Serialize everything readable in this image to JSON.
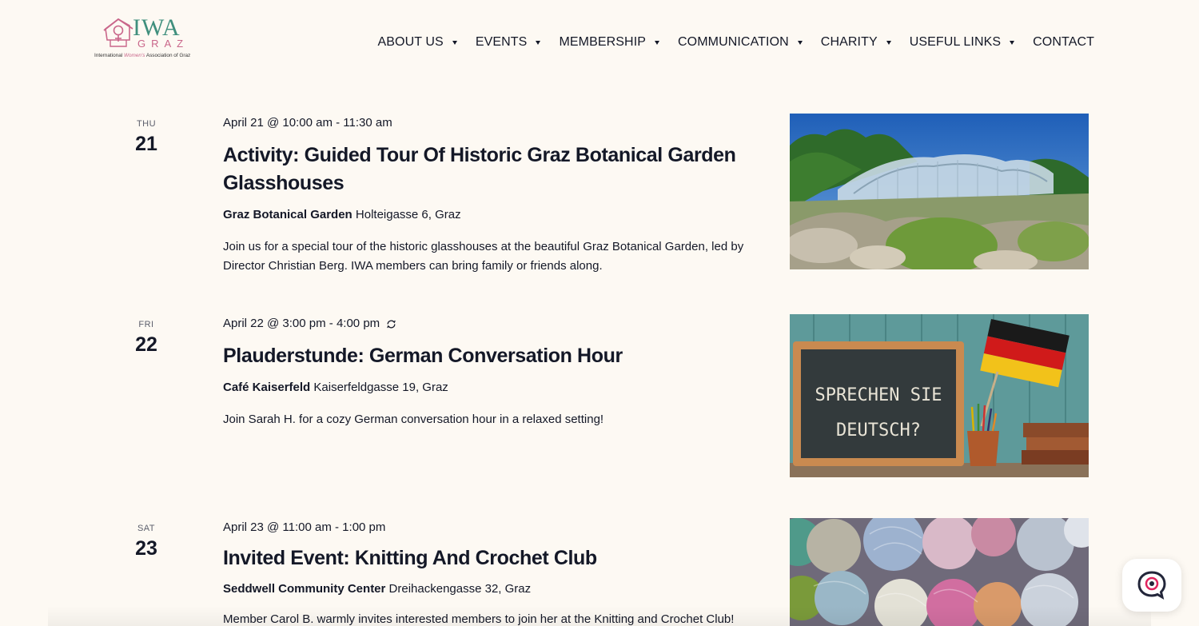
{
  "logo": {
    "word": "IWA",
    "sub": "GRAZ",
    "tagline_pre": "International ",
    "tagline_accent": "Women's",
    "tagline_post": " Association of Graz"
  },
  "nav": {
    "items": [
      {
        "label": "ABOUT US",
        "dropdown": true
      },
      {
        "label": "EVENTS",
        "dropdown": true
      },
      {
        "label": "MEMBERSHIP",
        "dropdown": true
      },
      {
        "label": "COMMUNICATION",
        "dropdown": true
      },
      {
        "label": "CHARITY",
        "dropdown": true
      },
      {
        "label": "USEFUL LINKS",
        "dropdown": true
      },
      {
        "label": "CONTACT",
        "dropdown": false
      }
    ]
  },
  "events": [
    {
      "dow": "THU",
      "day": "21",
      "when": "April 21 @ 10:00 am - 11:30 am",
      "recurring": false,
      "title": "Activity: Guided Tour Of Historic Graz Botanical Garden Glasshouses",
      "venue_name": "Graz Botanical Garden",
      "venue_address": "Holteigasse 6, Graz",
      "description": "Join us for a special tour of the historic glasshouses at the beautiful Graz Botanical Garden, led by Director Christian Berg. IWA members can bring family or friends along."
    },
    {
      "dow": "FRI",
      "day": "22",
      "when": "April 22 @ 3:00 pm - 4:00 pm",
      "recurring": true,
      "title": "Plauderstunde: German Conversation Hour",
      "venue_name": "Café Kaiserfeld",
      "venue_address": "Kaiserfeldgasse 19, Graz",
      "description": "Join Sarah H. for a cozy German conversation hour in a relaxed setting!",
      "image_text_line1": "SPRECHEN SIE",
      "image_text_line2": "DEUTSCH?"
    },
    {
      "dow": "SAT",
      "day": "23",
      "when": "April 23 @ 11:00 am - 1:00 pm",
      "recurring": false,
      "title": "Invited Event: Knitting And Crochet Club",
      "venue_name": "Seddwell Community Center",
      "venue_address": "Dreihackengasse 32, Graz",
      "description": "Member Carol B. warmly invites interested members to join her at the Knitting and Crochet Club!"
    }
  ],
  "colors": {
    "background": "#fdf9f3",
    "text": "#141827",
    "brand_teal": "#3f8f7d",
    "brand_pink": "#c9668a",
    "chat_accent": "#e0245e"
  },
  "icons": {
    "recurring": "recurring-icon",
    "chat": "chat-bubble-icon",
    "caret": "caret-down-icon"
  }
}
